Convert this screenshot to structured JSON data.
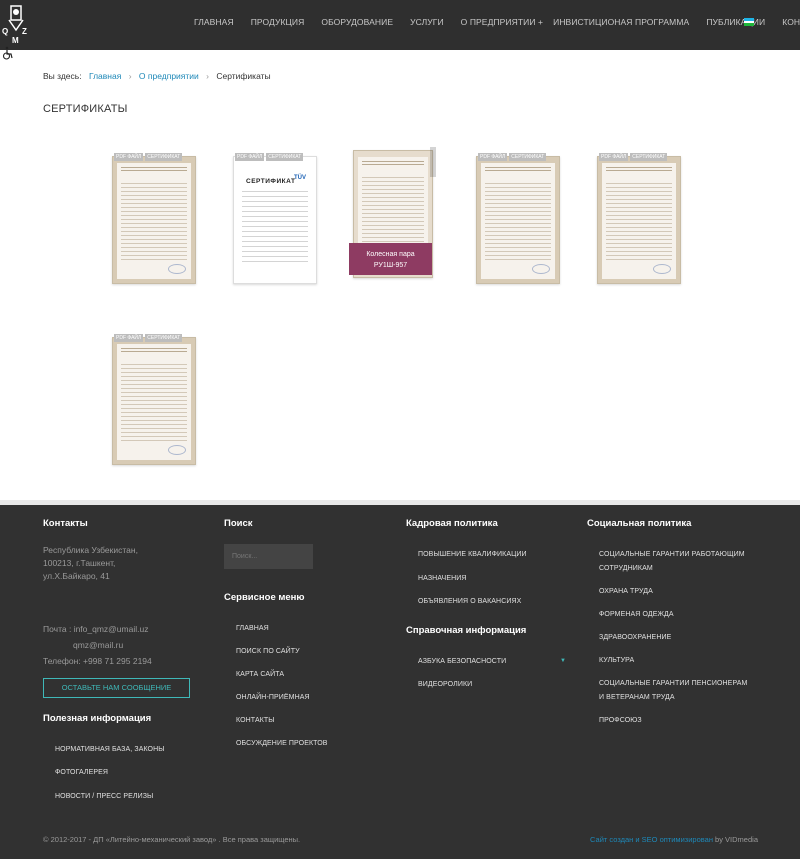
{
  "header": {
    "logo_text": "QTZM",
    "nav": [
      "Главная",
      "Продукция",
      "Оборудование",
      "Услуги",
      "О предприятии +",
      "Инвистиционая программа",
      "Публикации",
      "Контакты"
    ],
    "colors": {
      "bar": "#2f2f2f",
      "accent": "#1e88b8"
    },
    "accessibility_icon": "wheelchair-icon",
    "language_flag_icon": "uzbekistan-flag-icon"
  },
  "breadcrumb": {
    "prefix": "Вы здесь:",
    "items": [
      "Главная",
      "О предприятии",
      "Сертификаты"
    ]
  },
  "page_title": "Сертификаты",
  "certificates": [
    {
      "tags": [
        "PDF файл",
        "Сертификат"
      ],
      "style": "beige"
    },
    {
      "tags": [
        "PDF файл",
        "Сертификат"
      ],
      "style": "white",
      "title": "СЕРТИФИКАТ",
      "logo": "TÜV"
    },
    {
      "tags": [],
      "style": "hover",
      "caption_line1": "Колесная пара",
      "caption_line2": "РУ1Ш-957"
    },
    {
      "tags": [
        "PDF файл",
        "Сертификат"
      ],
      "style": "beige"
    },
    {
      "tags": [
        "PDF файл",
        "Сертификат"
      ],
      "style": "beige"
    },
    {
      "tags": [
        "PDF файл",
        "Сертификат"
      ],
      "style": "beige"
    }
  ],
  "footer": {
    "contacts": {
      "heading": "Контакты",
      "address": [
        "Республика Узбекистан,",
        "100213, г.Ташкент,",
        "ул.Х.Байкаро, 41"
      ],
      "email_line1": "Почта : info_qmz@umail.uz",
      "email_line2": "qmz@mail.ru",
      "phone": "Телефон: +998 71 295 2194",
      "button": "Оставьте нам сообщение"
    },
    "useful": {
      "heading": "Полезная информация",
      "links": [
        "Нормативная база, законы",
        "Фотогалерея",
        "Новости / пресс релизы"
      ]
    },
    "search": {
      "heading": "Поиск",
      "placeholder": "Поиск..."
    },
    "service_menu": {
      "heading": "Сервисное меню",
      "links": [
        "Главная",
        "Поиск по сайту",
        "Карта сайта",
        "Онлайн-приёмная",
        "Контакты",
        "Обсуждение проектов"
      ]
    },
    "hr_policy": {
      "heading": "Кадровая политика",
      "links": [
        "Повышение квалификации",
        "Назначения",
        "Объявления о вакансиях"
      ]
    },
    "reference": {
      "heading": "Справочная информация",
      "links": [
        "Азбука безопасности",
        "Видеоролики"
      ]
    },
    "social": {
      "heading": "Социальная политика",
      "links": [
        "Социальные гарантии работающим сотрудникам",
        "Охрана труда",
        "Форменая одежда",
        "Здравоохранение",
        "Культура",
        "Социальные гарантии пенсионерам и ветеранам труда",
        "Профсоюз"
      ]
    },
    "copyright": "© 2012-2017 - ДП «Литейно-механический завод» . Все права защищены.",
    "credit_link": "Сайт создан и SEO оптимизирован",
    "credit_by": " by VIDmedia"
  }
}
